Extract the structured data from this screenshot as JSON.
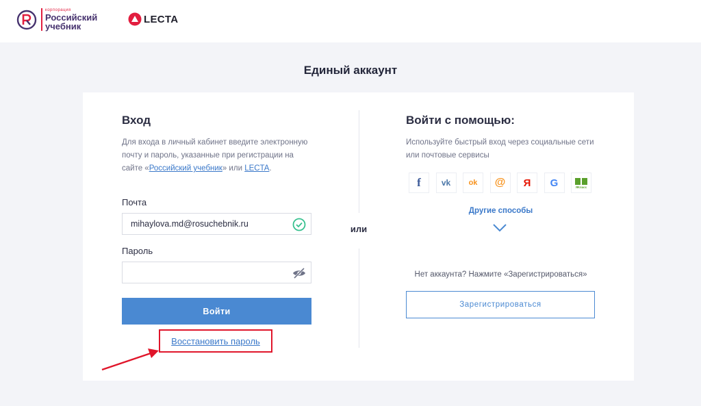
{
  "header": {
    "ru_logo": {
      "small": "корпорация",
      "line1": "Российский",
      "line2": "учебник"
    },
    "lecta_logo": "LECTA"
  },
  "page_title": "Единый аккаунт",
  "login": {
    "title": "Вход",
    "desc_before": "Для входа в личный кабинет введите электронную почту и пароль, указанные при регистрации на сайте «",
    "link_ru": "Российский учебник",
    "desc_middle": "» или ",
    "link_lecta": "LECTA",
    "desc_after": ".",
    "email_label": "Почта",
    "email_value": "mihaylova.md@rosuchebnik.ru",
    "password_label": "Пароль",
    "password_value": "",
    "submit_label": "Войти",
    "restore_label": "Восстановить пароль"
  },
  "or_label": "или",
  "social": {
    "title": "Войти с помощью:",
    "desc": "Используйте быстрый вход через социальные сети или почтовые сервисы",
    "icons": [
      {
        "name": "facebook-icon",
        "glyph": "f",
        "color": "#3b5998"
      },
      {
        "name": "vk-icon",
        "glyph": "vk",
        "color": "#4a76a8"
      },
      {
        "name": "odnoklassniki-icon",
        "glyph": "ok",
        "color": "#f7931e"
      },
      {
        "name": "mailru-icon",
        "glyph": "@",
        "color": "#f7931e"
      },
      {
        "name": "yandex-icon",
        "glyph": "Я",
        "color": "#e61400"
      },
      {
        "name": "google-icon",
        "glyph": "G",
        "color": "#4285f4"
      },
      {
        "name": "yaklass-icon",
        "glyph": "ЯКласс",
        "color": "#5aa02c"
      }
    ],
    "more_label": "Другие способы",
    "no_account_text": "Нет аккаунта? Нажмите «Зарегистрироваться»",
    "register_label": "Зарегистрироваться"
  },
  "colors": {
    "accent": "#4a89d2",
    "highlight": "#e0152a",
    "valid": "#36c08e"
  }
}
